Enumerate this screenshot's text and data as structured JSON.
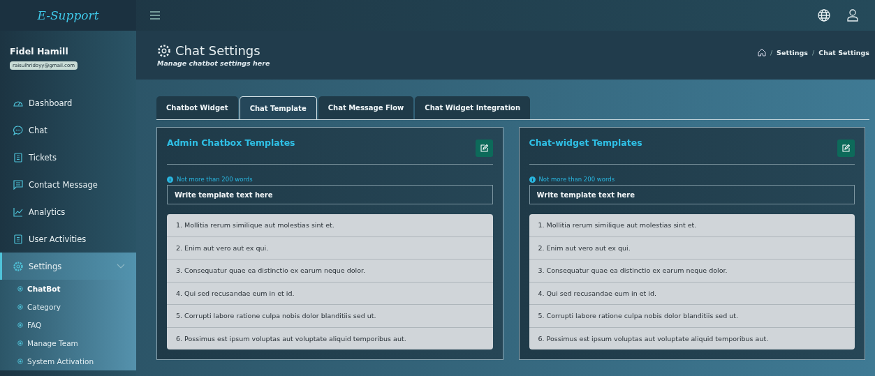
{
  "brand": "E-Support",
  "user": {
    "name": "Fidel Hamill",
    "email": "raisulhridoyy@gmail.com"
  },
  "sidebar": {
    "items": [
      {
        "label": "Dashboard",
        "selected": false
      },
      {
        "label": "Chat",
        "selected": false
      },
      {
        "label": "Tickets",
        "selected": false
      },
      {
        "label": "Contact Message",
        "selected": false
      },
      {
        "label": "Analytics",
        "selected": false
      },
      {
        "label": "User Activities",
        "selected": false
      },
      {
        "label": "Settings",
        "selected": true,
        "expanded": true,
        "children": [
          {
            "label": "ChatBot",
            "selected": true
          },
          {
            "label": "Category",
            "selected": false
          },
          {
            "label": "FAQ",
            "selected": false
          },
          {
            "label": "Manage Team",
            "selected": false
          },
          {
            "label": "System Activation",
            "selected": false
          }
        ]
      }
    ]
  },
  "header": {
    "title": "Chat Settings",
    "subtitle": "Manage chatbot settings here",
    "breadcrumb": [
      {
        "separator": "/",
        "label": "Settings"
      },
      {
        "separator": "/",
        "label": "Chat Settings"
      }
    ]
  },
  "tabs": [
    {
      "label": "Chatbot Widget",
      "selected": false
    },
    {
      "label": "Chat Template",
      "selected": true
    },
    {
      "label": "Chat Message Flow",
      "selected": false
    },
    {
      "label": "Chat Widget Integration",
      "selected": false
    }
  ],
  "cards": [
    {
      "title": "Admin Chatbox Templates",
      "hint": "Not more than 200 words",
      "placeholder": "Write template text here",
      "items": [
        "1. Mollitia rerum similique aut molestias sint et.",
        "2. Enim aut vero aut ex qui.",
        "3. Consequatur quae ea distinctio ex earum neque dolor.",
        "4. Qui sed recusandae eum in et id.",
        "5. Corrupti labore ratione culpa nobis dolor blanditiis sed ut.",
        "6. Possimus est ipsum voluptas aut voluptate aliquid temporibus aut."
      ]
    },
    {
      "title": "Chat-widget Templates",
      "hint": "Not more than 200 words",
      "placeholder": "Write template text here",
      "items": [
        "1. Mollitia rerum similique aut molestias sint et.",
        "2. Enim aut vero aut ex qui.",
        "3. Consequatur quae ea distinctio ex earum neque dolor.",
        "4. Qui sed recusandae eum in et id.",
        "5. Corrupti labore ratione culpa nobis dolor blanditiis sed ut.",
        "6. Possimus est ipsum voluptas aut voluptate aliquid temporibus aut."
      ]
    }
  ]
}
